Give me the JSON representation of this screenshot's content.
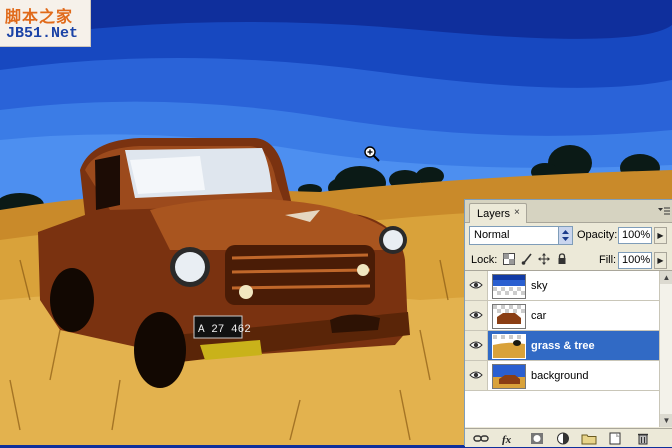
{
  "watermark": {
    "cn": "脚本之家",
    "en": "JB51.Net"
  },
  "layers_panel": {
    "tab_label": "Layers",
    "tab_close": "×",
    "blend_mode": "Normal",
    "opacity_label": "Opacity:",
    "opacity_value": "100%",
    "lock_label": "Lock:",
    "fill_label": "Fill:",
    "fill_value": "100%",
    "layers": [
      {
        "name": "sky",
        "visible": true,
        "selected": false
      },
      {
        "name": "car",
        "visible": true,
        "selected": false
      },
      {
        "name": "grass & tree",
        "visible": true,
        "selected": true
      },
      {
        "name": "background",
        "visible": true,
        "selected": false
      }
    ],
    "bottom_icons": [
      "link-icon",
      "fx-icon",
      "mask-icon",
      "adjustment-icon",
      "group-folder-icon",
      "new-layer-icon",
      "trash-icon"
    ]
  },
  "colors": {
    "selection": "#316ac5",
    "panel_bg": "#ece9d8",
    "sky_dark": "#0f2f9c",
    "sky_light": "#3a7ae0",
    "grass": "#d9a23a",
    "truck": "#8a3e14"
  },
  "license_plate": "A 27 462"
}
